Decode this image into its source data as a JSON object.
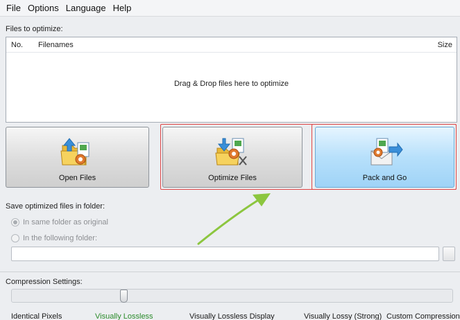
{
  "menu": {
    "items": [
      "File",
      "Options",
      "Language",
      "Help"
    ]
  },
  "files_section": {
    "label": "Files to optimize:",
    "columns": {
      "no": "No.",
      "filenames": "Filenames",
      "size": "Size"
    },
    "drop_hint": "Drag & Drop files here to optimize"
  },
  "buttons": {
    "open_files": "Open Files",
    "optimize_files": "Optimize Files",
    "pack_and_go": "Pack and Go"
  },
  "save_section": {
    "label": "Save optimized files in folder:",
    "option_same": "In same folder as original",
    "option_following": "In the following folder:",
    "folder_value": "",
    "selected_option": "same"
  },
  "compression": {
    "label": "Compression Settings:",
    "levels": [
      "Identical Pixels",
      "Visually Lossless",
      "Visually Lossless Display",
      "Visually Lossy (Strong)",
      "Custom Compression"
    ],
    "selected_index": 1
  },
  "colors": {
    "annotation_box": "#e04545",
    "annotation_arrow": "#8cc63f",
    "selected_level": "#2b8b2b",
    "hover_button": "#b7e0fb"
  }
}
